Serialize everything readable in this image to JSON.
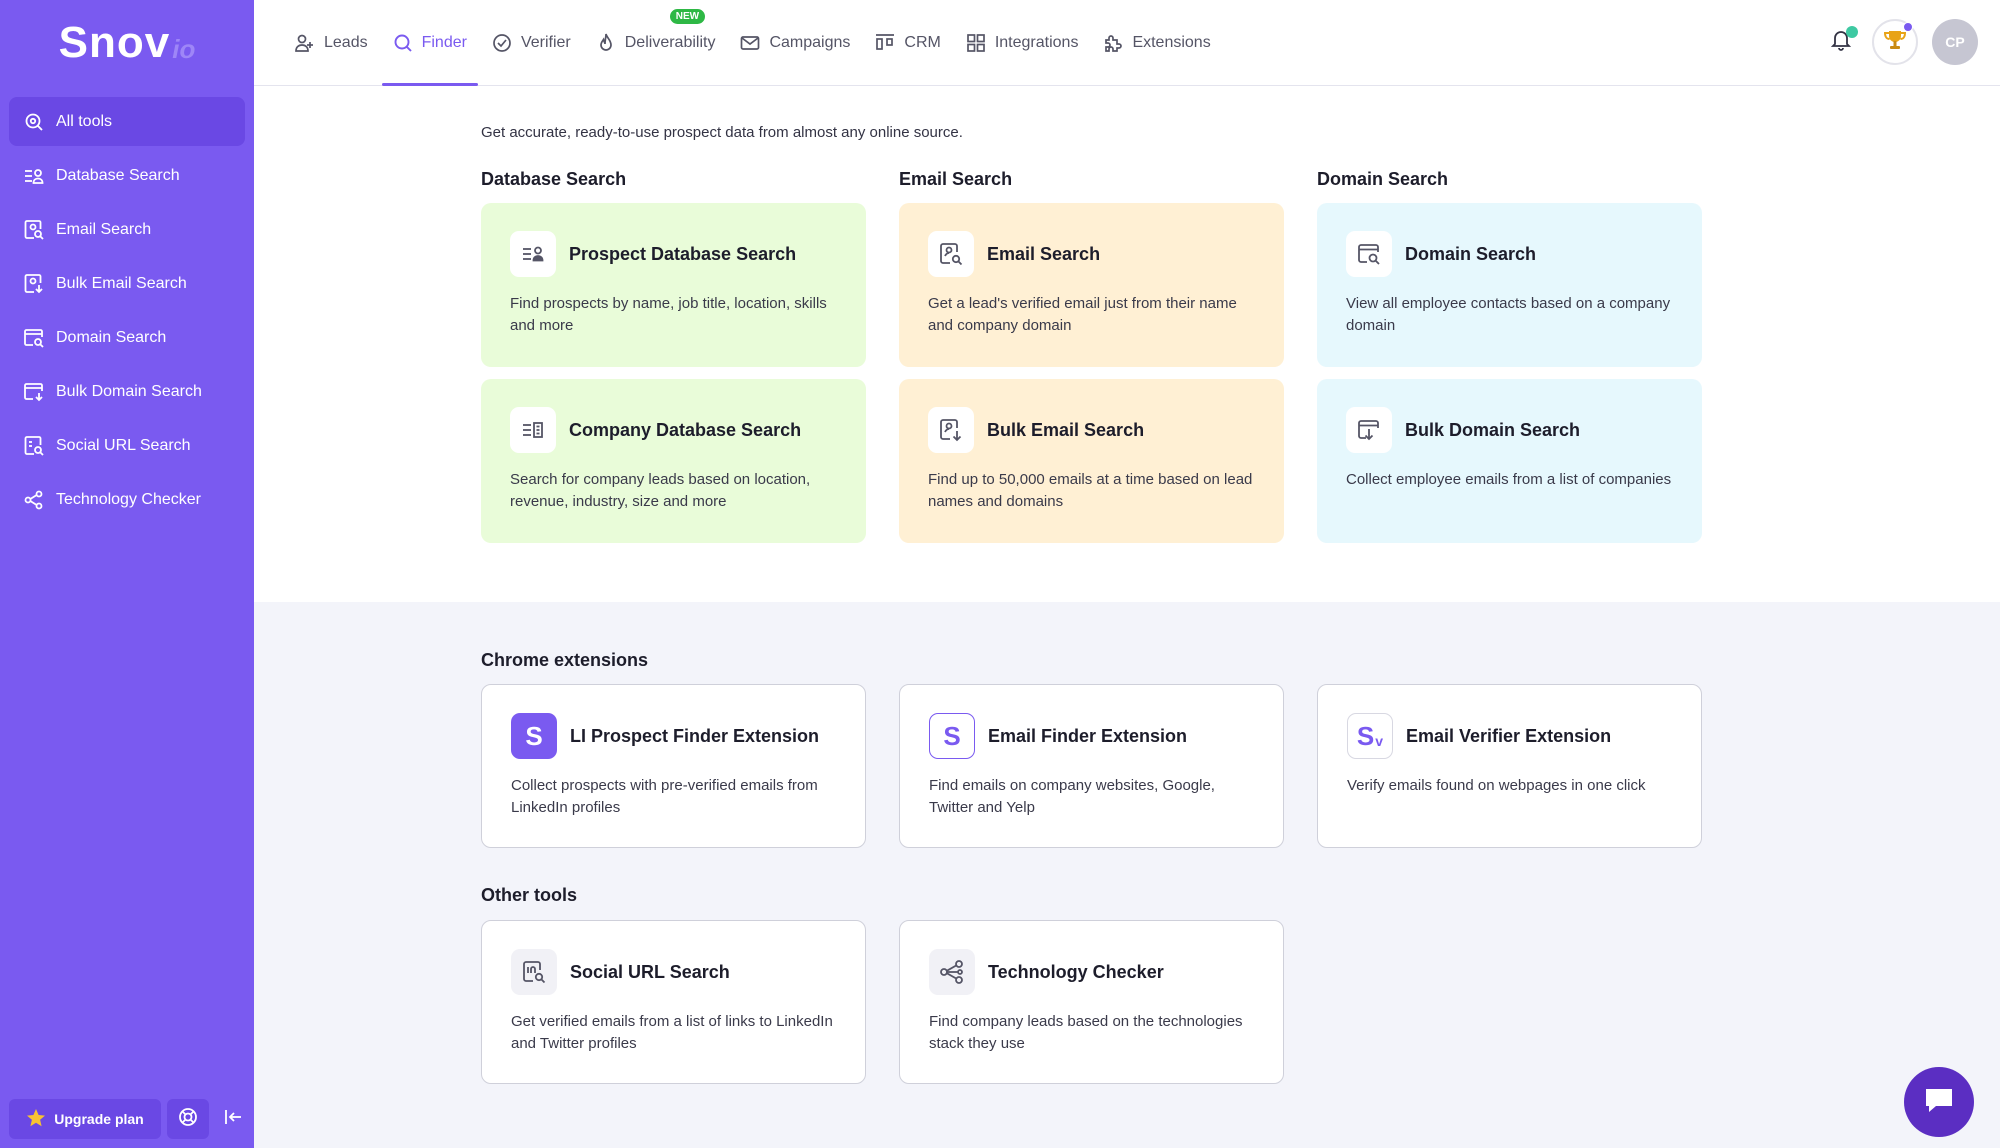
{
  "brand": {
    "name": "Snov",
    "suffix": "io"
  },
  "sidebar": {
    "items": [
      {
        "label": "All tools",
        "icon": "search-all-icon",
        "active": true
      },
      {
        "label": "Database Search",
        "icon": "database-search-icon"
      },
      {
        "label": "Email Search",
        "icon": "email-search-icon"
      },
      {
        "label": "Bulk Email Search",
        "icon": "bulk-email-search-icon"
      },
      {
        "label": "Domain Search",
        "icon": "domain-search-icon"
      },
      {
        "label": "Bulk Domain Search",
        "icon": "bulk-domain-search-icon"
      },
      {
        "label": "Social URL Search",
        "icon": "social-url-search-icon"
      },
      {
        "label": "Technology Checker",
        "icon": "technology-checker-icon"
      }
    ],
    "upgrade_label": "Upgrade plan"
  },
  "topnav": {
    "tabs": [
      {
        "label": "Leads",
        "icon": "leads-icon"
      },
      {
        "label": "Finder",
        "icon": "finder-icon",
        "active": true
      },
      {
        "label": "Verifier",
        "icon": "verifier-icon"
      },
      {
        "label": "Deliverability",
        "icon": "deliverability-icon",
        "badge": "NEW"
      },
      {
        "label": "Campaigns",
        "icon": "campaigns-icon"
      },
      {
        "label": "CRM",
        "icon": "crm-icon"
      },
      {
        "label": "Integrations",
        "icon": "integrations-icon"
      },
      {
        "label": "Extensions",
        "icon": "extensions-icon"
      }
    ],
    "avatar_initials": "CP"
  },
  "main": {
    "intro": "Get accurate, ready-to-use prospect data from almost any online source.",
    "sections": {
      "database": "Database Search",
      "email": "Email Search",
      "domain": "Domain Search",
      "chrome": "Chrome extensions",
      "other": "Other tools"
    },
    "cards": {
      "prospect_db": {
        "title": "Prospect Database Search",
        "desc": "Find prospects by name, job title, location, skills and more"
      },
      "company_db": {
        "title": "Company Database Search",
        "desc": "Search for company leads based on location, revenue, industry, size and more"
      },
      "email_search": {
        "title": "Email Search",
        "desc": "Get a lead's verified email just from their name and company domain"
      },
      "bulk_email": {
        "title": "Bulk Email Search",
        "desc": "Find up to 50,000 emails at a time based on lead names and domains"
      },
      "domain_search": {
        "title": "Domain Search",
        "desc": "View all employee contacts based on a company domain"
      },
      "bulk_domain": {
        "title": "Bulk Domain Search",
        "desc": "Collect employee emails from a list of companies"
      },
      "li_ext": {
        "title": "LI Prospect Finder Extension",
        "desc": "Collect prospects with pre-verified emails from LinkedIn profiles",
        "glyph": "S"
      },
      "email_finder_ext": {
        "title": "Email Finder Extension",
        "desc": "Find emails on company websites, Google, Twitter and Yelp",
        "glyph": "S"
      },
      "email_verifier_ext": {
        "title": "Email Verifier Extension",
        "desc": "Verify emails found on webpages in one click",
        "glyph": "S",
        "glyph_sub": "v"
      },
      "social_url": {
        "title": "Social URL Search",
        "desc": "Get verified emails from a list of links to LinkedIn and Twitter profiles"
      },
      "tech_checker": {
        "title": "Technology Checker",
        "desc": "Find company leads based on the technologies stack they use"
      }
    }
  },
  "colors": {
    "sidebar": "#7a5af0",
    "accent": "#7a5af0",
    "green_card": "#e9fcd9",
    "orange_card": "#fff0d4",
    "blue_card": "#e6f8fd",
    "new_badge": "#2eb845"
  }
}
